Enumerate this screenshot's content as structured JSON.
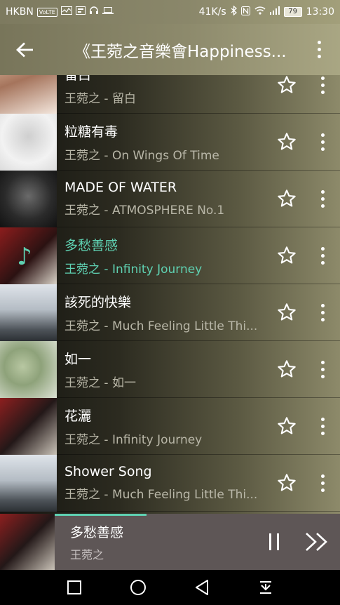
{
  "status_bar": {
    "carrier": "HKBN",
    "volte": "VoLTE",
    "speed": "41K/s",
    "battery": "79",
    "time": "13:30"
  },
  "app_bar": {
    "title": "《王菀之音樂會Happiness..."
  },
  "songs": [
    {
      "title": "留白",
      "subtitle": "王菀之 - 留白",
      "art": "art-a",
      "active": false
    },
    {
      "title": "粒糖有毒",
      "subtitle": "王菀之 - On Wings Of Time",
      "art": "art-b",
      "active": false
    },
    {
      "title": "MADE OF WATER",
      "subtitle": "王菀之 - ATMOSPHERE No.1",
      "art": "art-c",
      "active": false
    },
    {
      "title": "多愁善感",
      "subtitle": "王菀之 - Infinity Journey",
      "art": "art-d",
      "active": true
    },
    {
      "title": "該死的快樂",
      "subtitle": "王菀之 - Much Feeling Little Thi...",
      "art": "art-e",
      "active": false
    },
    {
      "title": "如一",
      "subtitle": "王菀之 - 如一",
      "art": "art-f",
      "active": false
    },
    {
      "title": "花灑",
      "subtitle": "王菀之 - Infinity Journey",
      "art": "art-g",
      "active": false
    },
    {
      "title": "Shower Song",
      "subtitle": "王菀之 - Much Feeling Little Thi...",
      "art": "art-e",
      "active": false
    }
  ],
  "now_playing": {
    "title": "多愁善感",
    "artist": "王菀之",
    "progress": 0.43
  },
  "colors": {
    "accent": "#5fd1b2",
    "now_playing_bg": "#5e5656"
  },
  "icons": {
    "back": "arrow-left-icon",
    "more": "more-vertical-icon",
    "star": "star-outline-icon",
    "pause": "pause-icon",
    "next": "fast-forward-icon",
    "nav_square": "recent-apps-icon",
    "nav_circle": "home-icon",
    "nav_triangle": "back-icon",
    "nav_down": "notification-pull-icon"
  }
}
